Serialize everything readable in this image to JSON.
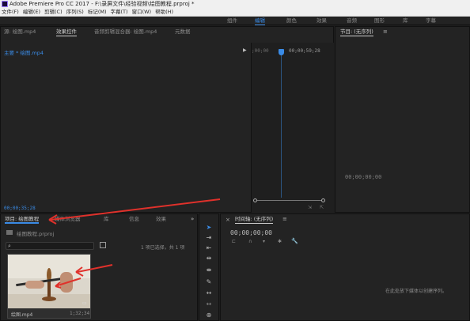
{
  "window": {
    "title": "Adobe Premiere Pro CC 2017 - F:\\录屏文件\\经验视频\\绘图教程.prproj *"
  },
  "menu": [
    "文件(F)",
    "编辑(E)",
    "剪辑(C)",
    "序列(S)",
    "标记(M)",
    "字幕(T)",
    "窗口(W)",
    "帮助(H)"
  ],
  "workspaces": [
    "组件",
    "编辑",
    "颜色",
    "效果",
    "音频",
    "图形",
    "库",
    "字幕"
  ],
  "active_workspace_index": 1,
  "source_panel": {
    "tabs": [
      "源: 绘图.mp4",
      "效果控件",
      "音频剪辑混合器: 绘图.mp4",
      "元数据"
    ],
    "active_tab_index": 1,
    "clip_label": "主要 * 绘图.mp4",
    "ruler_start": ";00;00",
    "ruler_end": "00;00;59;28",
    "timecode": "00;00;35;28"
  },
  "program_panel": {
    "title": "节目: (无序列)",
    "timecode": "00;00;00;00"
  },
  "project_panel": {
    "tabs": [
      "项目: 绘图教程",
      "媒体浏览器",
      "库",
      "信息",
      "效果"
    ],
    "active_tab_index": 0,
    "project_file": "绘图教程.prproj",
    "selection_info": "1 项已选择，共 1 项",
    "search_placeholder": "",
    "media_item": {
      "name": "绘图.mp4",
      "duration": "1;32;34"
    }
  },
  "timeline_panel": {
    "title": "时间轴: (无序列)",
    "timecode": "00;00;00;00",
    "empty_message": "在此处放下媒体以创建序列。"
  },
  "tools": [
    "selection-tool",
    "track-select-tool",
    "ripple-edit-tool",
    "rolling-edit-tool",
    "rate-stretch-tool",
    "razor-tool",
    "slip-tool",
    "slide-tool",
    "pen-tool"
  ],
  "colors": {
    "accent": "#3a8be6",
    "annotation_arrow": "#e0312b"
  }
}
